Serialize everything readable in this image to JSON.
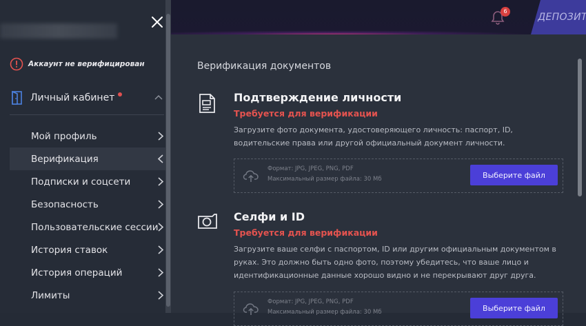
{
  "header": {
    "notifications_count": "6",
    "deposit_label": "ДЕПОЗИТ"
  },
  "sidebar": {
    "account_status": "Аккаунт не верифицирован",
    "section_label": "Личный кабинет",
    "items": [
      {
        "label": "Мой профиль"
      },
      {
        "label": "Верификация"
      },
      {
        "label": "Подписки и соцсети"
      },
      {
        "label": "Безопасность"
      },
      {
        "label": "Пользовательские сессии"
      },
      {
        "label": "История ставок"
      },
      {
        "label": "История операций"
      },
      {
        "label": "Лимиты"
      }
    ]
  },
  "main": {
    "page_title": "Верификация документов",
    "sections": [
      {
        "title": "Подтверждение личности",
        "requirement": "Требуется для верификации",
        "description": "Загрузите фото документа, удостоверяющего личность: паспорт, ID, водительские права или другой официальный документ личности.",
        "formats": "Формат: JPG, JPEG, PNG, PDF",
        "max_size": "Максимальный размер файла: 30 Мб",
        "button_label": "Выберите файл"
      },
      {
        "title": "Селфи и ID",
        "requirement": "Требуется для верификации",
        "description": "Загрузите ваше селфи с паспортом, ID или другим официальным документом в руках. Это должно быть одно фото, поэтому убедитесь, что ваше лицо и идентификационные данные хорошо видно и не перекрывают друг друга.",
        "formats": "Формат: JPG, JPEG, PNG, PDF",
        "max_size": "Максимальный размер файла: 30 Мб",
        "button_label": "Выберите файл"
      }
    ]
  },
  "colors": {
    "accent": "#4b3fd8",
    "warning": "#e5534f",
    "sidebar_bg": "#262c37",
    "main_bg": "#2b313c"
  }
}
